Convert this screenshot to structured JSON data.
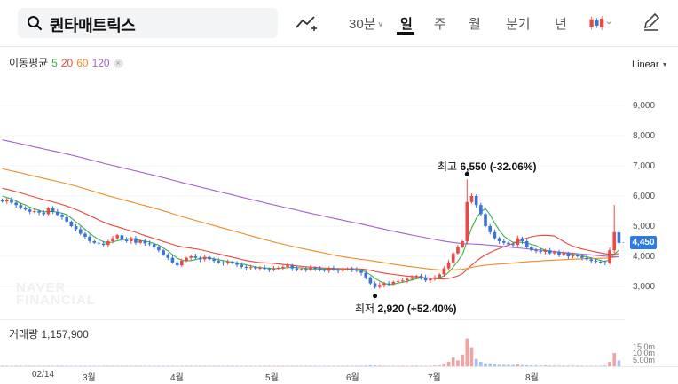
{
  "search": {
    "query": "퀀타매트릭스",
    "icon": "search-icon"
  },
  "periods": [
    {
      "label": "30분",
      "active": false,
      "dropdown": true
    },
    {
      "label": "일",
      "active": true
    },
    {
      "label": "주",
      "active": false
    },
    {
      "label": "월",
      "active": false
    },
    {
      "label": "분기",
      "active": false
    },
    {
      "label": "년",
      "active": false
    }
  ],
  "moving_average": {
    "label": "이동평균",
    "periods": [
      {
        "label": "5",
        "color": "#3fb049"
      },
      {
        "label": "20",
        "color": "#e8473c"
      },
      {
        "label": "60",
        "color": "#f08a24"
      },
      {
        "label": "120",
        "color": "#a45fd0"
      }
    ],
    "close_icon": "×"
  },
  "scale_mode": "Linear",
  "watermark": [
    "NAVER",
    "FINANCIAL"
  ],
  "volume": {
    "label": "거래량 1,157,900"
  },
  "colors": {
    "up": "#e84a4a",
    "down": "#3b73d9",
    "current_price_tag": "#2f7be5"
  },
  "chart_data": {
    "type": "candlestick",
    "y_ticks": [
      "9,000",
      "8,000",
      "7,000",
      "6,000",
      "5,000",
      "4,000",
      "3,000"
    ],
    "y_tick_values": [
      9000,
      8000,
      7000,
      6000,
      5000,
      4000,
      3000
    ],
    "ylim": [
      2450,
      10000
    ],
    "current_price": "4,450",
    "current_price_value": 4450,
    "annotations": {
      "high": {
        "prefix": "최고",
        "value": "6,550",
        "change": "(-32.06%)"
      },
      "low": {
        "prefix": "최저",
        "value": "2,920",
        "change": "(+52.40%)"
      }
    },
    "x_ticks": [
      "02/14",
      "3월",
      "4월",
      "5월",
      "6월",
      "7월",
      "8월"
    ],
    "x_tick_positions": [
      6,
      14,
      35,
      57,
      77,
      95,
      116
    ],
    "total_days": 135,
    "vol_ticks": [
      "15.0m",
      "10.0m",
      "5.00m"
    ],
    "vol_tick_values": [
      15,
      10,
      5
    ],
    "vol_max": 20,
    "closes": [
      5820,
      5880,
      5780,
      5700,
      5620,
      5550,
      5480,
      5500,
      5450,
      5400,
      5600,
      5480,
      5380,
      5300,
      5150,
      5000,
      4900,
      4750,
      4650,
      4500,
      4450,
      4420,
      4380,
      4500,
      4600,
      4700,
      4550,
      4500,
      4600,
      4450,
      4520,
      4430,
      4400,
      4300,
      4200,
      4050,
      3950,
      3800,
      3700,
      3850,
      3950,
      4000,
      3950,
      3900,
      3980,
      3900,
      3850,
      3800,
      3780,
      3820,
      3780,
      3720,
      3650,
      3620,
      3640,
      3600,
      3620,
      3580,
      3560,
      3600,
      3620,
      3650,
      3700,
      3600,
      3560,
      3580,
      3550,
      3620,
      3600,
      3560,
      3520,
      3600,
      3560,
      3520,
      3560,
      3590,
      3550,
      3520,
      3450,
      3300,
      3100,
      2980,
      3050,
      3100,
      3080,
      3150,
      3180,
      3200,
      3250,
      3300,
      3350,
      3300,
      3200,
      3250,
      3300,
      3400,
      3600,
      3800,
      4100,
      4300,
      4500,
      5800,
      6000,
      5700,
      5400,
      5000,
      4800,
      4600,
      4500,
      4450,
      4400,
      4380,
      4600,
      4500,
      4300,
      4200,
      4180,
      4150,
      4200,
      4100,
      4150,
      4050,
      4100,
      4000,
      4050,
      4000,
      3950,
      3900,
      3850,
      3820,
      3800,
      3780,
      4200,
      4800,
      4450
    ],
    "volumes": [
      0.2,
      0.3,
      0.2,
      0.2,
      0.3,
      0.2,
      0.2,
      0.2,
      0.2,
      0.2,
      0.3,
      0.2,
      0.2,
      0.2,
      0.3,
      0.3,
      0.2,
      0.3,
      0.2,
      0.2,
      0.2,
      0.2,
      0.2,
      0.3,
      0.2,
      0.2,
      0.2,
      0.2,
      0.2,
      0.2,
      0.2,
      0.2,
      0.2,
      0.2,
      0.2,
      0.3,
      0.3,
      0.3,
      0.2,
      0.2,
      0.2,
      0.2,
      0.2,
      0.2,
      0.2,
      0.2,
      0.2,
      0.2,
      0.2,
      0.2,
      0.2,
      0.2,
      0.2,
      0.2,
      0.2,
      0.2,
      0.2,
      0.2,
      0.2,
      0.2,
      0.2,
      0.2,
      0.2,
      0.2,
      0.2,
      0.2,
      0.2,
      0.2,
      0.2,
      0.2,
      0.2,
      0.2,
      0.2,
      0.2,
      0.2,
      0.2,
      0.2,
      0.2,
      0.3,
      0.4,
      0.6,
      0.5,
      0.4,
      0.3,
      0.3,
      0.3,
      0.3,
      0.3,
      0.3,
      0.3,
      0.4,
      0.3,
      0.3,
      0.3,
      0.4,
      0.5,
      1.5,
      3.0,
      6.0,
      4.0,
      8.0,
      19.0,
      13.0,
      5.0,
      3.0,
      2.0,
      2.0,
      1.5,
      1.0,
      1.0,
      1.0,
      0.8,
      1.2,
      0.8,
      0.6,
      0.5,
      0.5,
      0.4,
      0.5,
      0.4,
      0.4,
      0.4,
      0.4,
      0.4,
      0.4,
      0.4,
      0.3,
      0.3,
      0.3,
      0.3,
      0.3,
      0.4,
      3.0,
      9.0,
      4.0
    ]
  }
}
